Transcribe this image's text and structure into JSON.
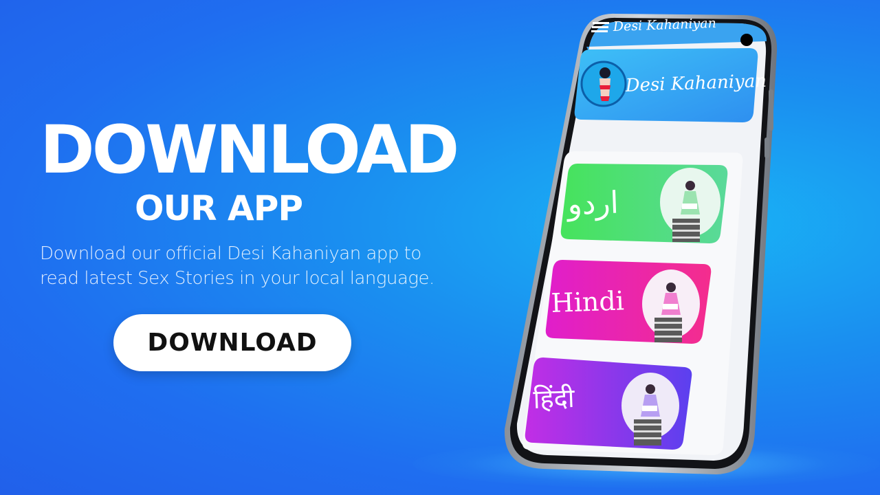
{
  "promo": {
    "headline": "DOWNLOAD",
    "subheadline": "OUR APP",
    "description_lines": [
      "Download our official Desi Kahaniyan app to",
      "read latest Sex Stories in your local language."
    ],
    "download_button_label": "DOWNLOAD"
  },
  "app": {
    "title": "Desi Kahaniyan",
    "banner_title": "Desi Kahaniyan",
    "languages": [
      {
        "label": "اردو",
        "color_start": "#4be25a",
        "color_end": "#4ad888"
      },
      {
        "label": "Hindi",
        "color_start": "#e11ec8",
        "color_end": "#f22f8e"
      },
      {
        "label": "हिंदी",
        "color_start": "#b52fe8",
        "color_end": "#6a3cf0"
      }
    ]
  },
  "colors": {
    "background": "#1f7ef0",
    "button_bg": "#ffffff",
    "button_text": "#111111",
    "app_header": "#3aa8f2"
  }
}
